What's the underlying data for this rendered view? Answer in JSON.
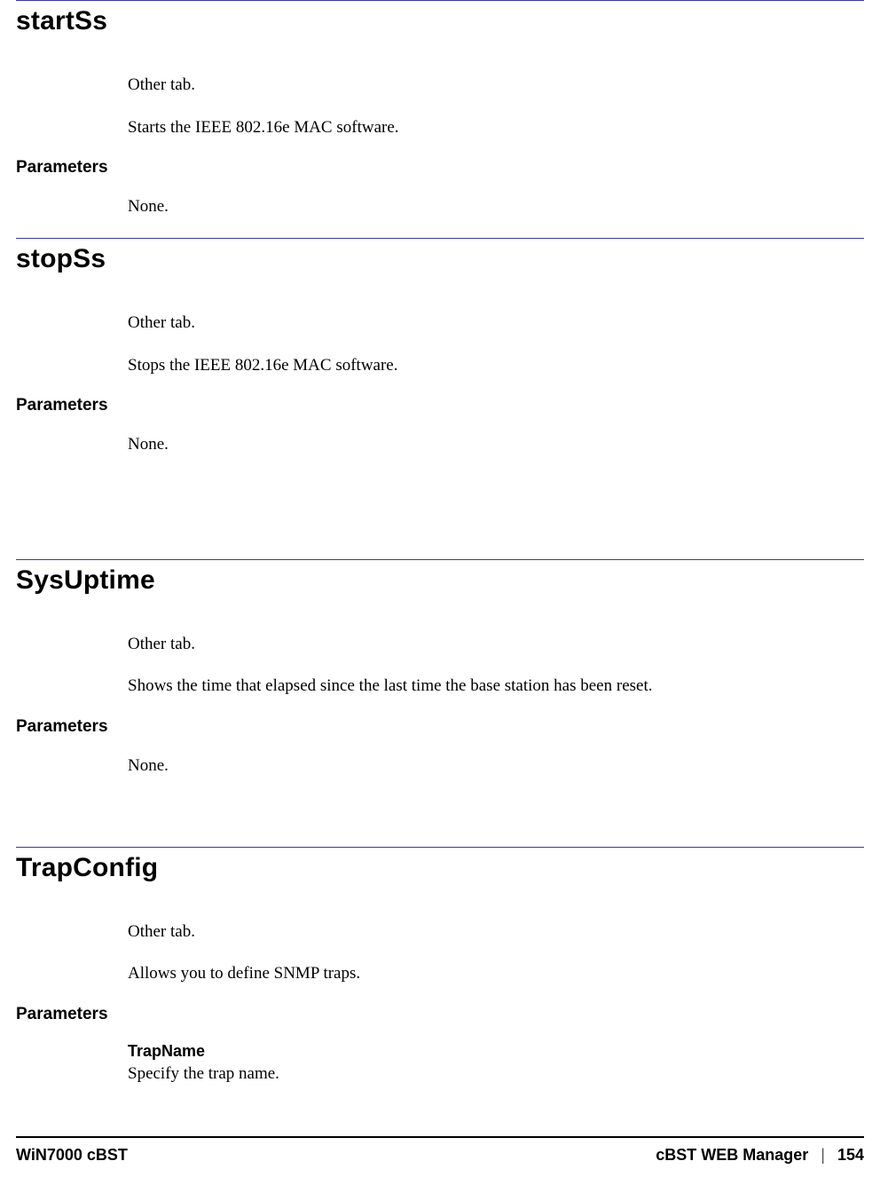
{
  "sections": [
    {
      "title": "startSs",
      "tab": "Other tab.",
      "desc": "Starts the IEEE 802.16e MAC software.",
      "params_label": "Parameters",
      "params_body": "None."
    },
    {
      "title": "stopSs",
      "tab": "Other tab.",
      "desc": "Stops the IEEE 802.16e MAC software.",
      "params_label": "Parameters",
      "params_body": "None."
    },
    {
      "title": "SysUptime",
      "tab": "Other tab.",
      "desc": "Shows the time that elapsed since the last time the base station has been reset.",
      "params_label": "Parameters",
      "params_body": "None."
    },
    {
      "title": "TrapConfig",
      "tab": "Other tab.",
      "desc": "Allows you to define SNMP traps.",
      "params_label": "Parameters",
      "params_list": [
        {
          "name": "TrapName",
          "desc": "Specify the trap name."
        }
      ]
    }
  ],
  "footer": {
    "left": "WiN7000 cBST",
    "right_title": "cBST WEB Manager",
    "sep": "|",
    "page": "154"
  }
}
